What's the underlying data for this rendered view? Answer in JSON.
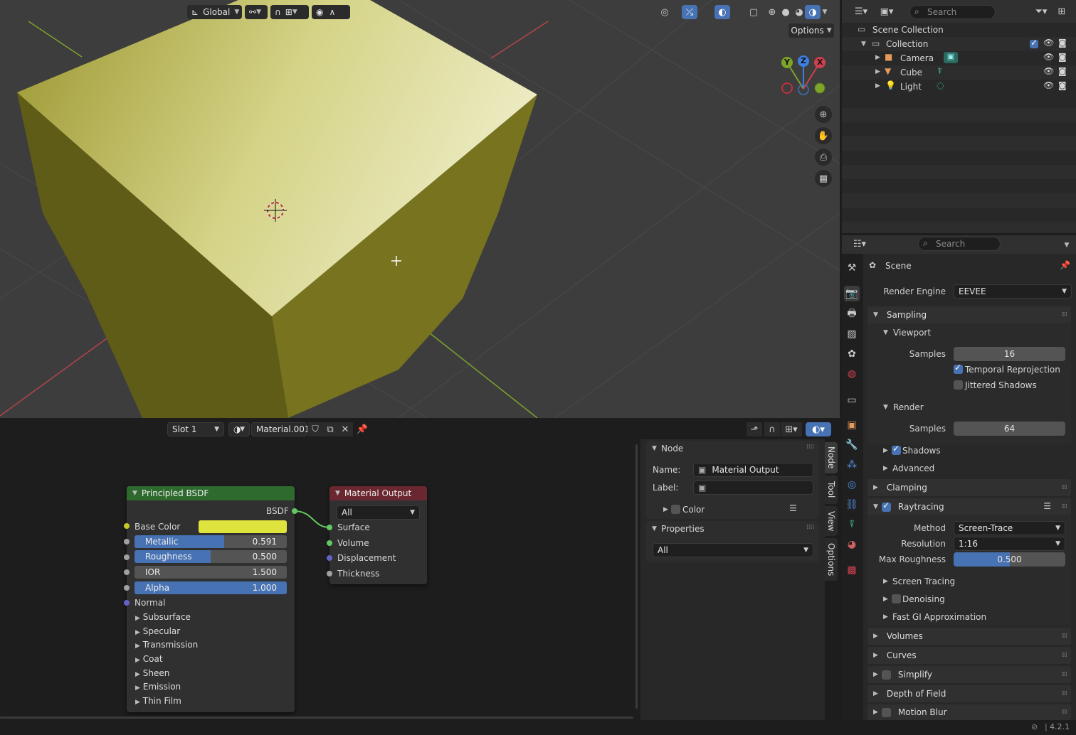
{
  "viewport": {
    "orientation": "Global",
    "options_label": "Options",
    "gizmo": {
      "y": "Y",
      "z": "Z",
      "x": "X"
    },
    "colors": {
      "cube_top": "#e3e29e",
      "cube_side": "#6e6b1e",
      "background": "#3d3d3d",
      "x_axis": "#c0404a",
      "y_axis": "#7ca32a"
    }
  },
  "outliner": {
    "search_placeholder": "Search",
    "scene_collection": "Scene Collection",
    "items": [
      {
        "label": "Collection",
        "icon": "collection-icon"
      },
      {
        "label": "Camera",
        "icon": "camera-icon"
      },
      {
        "label": "Cube",
        "icon": "mesh-icon"
      },
      {
        "label": "Light",
        "icon": "light-icon"
      }
    ]
  },
  "properties": {
    "search_placeholder": "Search",
    "context": "Scene",
    "render_engine_label": "Render Engine",
    "render_engine_value": "EEVEE",
    "sampling": "Sampling",
    "viewport": "Viewport",
    "samples_label": "Samples",
    "viewport_samples": "16",
    "temporal_reprojection": "Temporal Reprojection",
    "jittered_shadows": "Jittered Shadows",
    "render": "Render",
    "render_samples": "64",
    "shadows": "Shadows",
    "advanced": "Advanced",
    "clamping": "Clamping",
    "raytracing": "Raytracing",
    "method_label": "Method",
    "method_value": "Screen-Trace",
    "resolution_label": "Resolution",
    "resolution_value": "1:16",
    "max_roughness_label": "Max Roughness",
    "max_roughness_value": "0.500",
    "max_roughness_fraction": 0.5,
    "screen_tracing": "Screen Tracing",
    "denoising": "Denoising",
    "fast_gi": "Fast GI Approximation",
    "volumes": "Volumes",
    "curves": "Curves",
    "simplify": "Simplify",
    "dof": "Depth of Field",
    "motion_blur": "Motion Blur"
  },
  "node_editor": {
    "slot": "Slot 1",
    "material_name": "Material.001",
    "principled": {
      "title": "Principled BSDF",
      "output": "BSDF",
      "base_color_label": "Base Color",
      "base_color": "#dfe33d",
      "sliders": [
        {
          "label": "Metallic",
          "value": "0.591",
          "fraction": 0.591,
          "blue": true
        },
        {
          "label": "Roughness",
          "value": "0.500",
          "fraction": 0.5,
          "blue": true
        },
        {
          "label": "IOR",
          "value": "1.500",
          "fraction": 0,
          "blue": false
        },
        {
          "label": "Alpha",
          "value": "1.000",
          "fraction": 1,
          "blue": true
        }
      ],
      "normal": "Normal",
      "panels": [
        "Subsurface",
        "Specular",
        "Transmission",
        "Coat",
        "Sheen",
        "Emission",
        "Thin Film"
      ]
    },
    "output": {
      "title": "Material Output",
      "target": "All",
      "inputs": [
        "Surface",
        "Volume",
        "Displacement",
        "Thickness"
      ]
    },
    "sidebar": {
      "node_header": "Node",
      "name_label": "Name:",
      "name_value": "Material Output",
      "label_label": "Label:",
      "label_value": "",
      "color": "Color",
      "properties": "Properties",
      "properties_value": "All",
      "tabs": [
        "Node",
        "Tool",
        "View",
        "Options"
      ]
    }
  },
  "status_bar": {
    "version": "4.2.1"
  }
}
